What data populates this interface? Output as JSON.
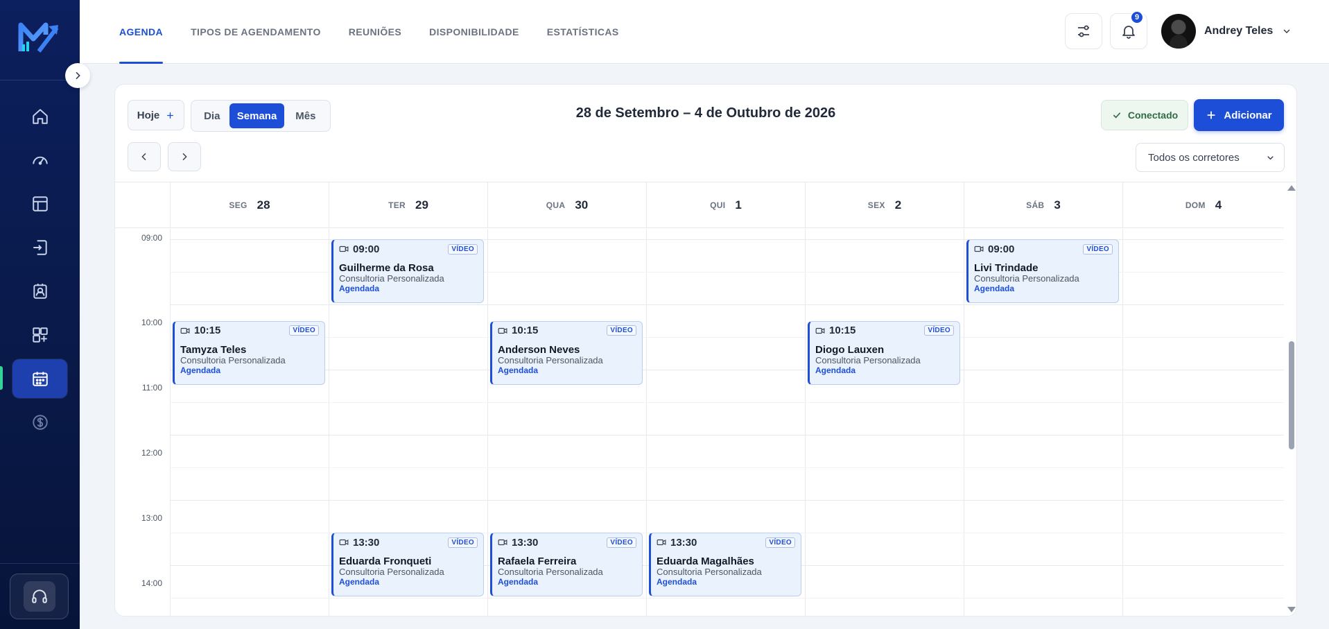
{
  "app": {
    "title": "Agenda"
  },
  "colors": {
    "accent": "#1d4ed8",
    "sidebar": "#0c1f5e",
    "active_indicator": "#34d399",
    "event_bg": "#eaf2fd"
  },
  "sidebar": {
    "items": [
      {
        "icon": "home-icon"
      },
      {
        "icon": "gauge-icon"
      },
      {
        "icon": "layout-icon"
      },
      {
        "icon": "file-import-icon"
      },
      {
        "icon": "contact-icon"
      },
      {
        "icon": "widgets-add-icon"
      },
      {
        "icon": "calendar-icon",
        "active": true
      },
      {
        "icon": "dollar-icon"
      }
    ],
    "support_icon": "headset-icon"
  },
  "header": {
    "tabs": [
      {
        "label": "AGENDA",
        "active": true
      },
      {
        "label": "TIPOS DE AGENDAMENTO"
      },
      {
        "label": "REUNIÕES"
      },
      {
        "label": "DISPONIBILIDADE"
      },
      {
        "label": "ESTATÍSTICAS"
      }
    ],
    "notifications_count": "9",
    "user_name": "Andrey Teles"
  },
  "toolbar": {
    "today_label": "Hoje",
    "views": [
      {
        "label": "Dia"
      },
      {
        "label": "Semana",
        "active": true
      },
      {
        "label": "Mês"
      }
    ],
    "range_title": "28 de Setembro – 4 de Outubro de 2026",
    "connected_label": "Conectado",
    "add_label": "Adicionar",
    "broker_filter": "Todos os corretores"
  },
  "calendar": {
    "days": [
      {
        "name": "SEG",
        "date": "28"
      },
      {
        "name": "TER",
        "date": "29"
      },
      {
        "name": "QUA",
        "date": "30"
      },
      {
        "name": "QUI",
        "date": "1"
      },
      {
        "name": "SEX",
        "date": "2"
      },
      {
        "name": "SÁB",
        "date": "3"
      },
      {
        "name": "DOM",
        "date": "4"
      }
    ],
    "hours": [
      "09:00",
      "10:00",
      "11:00",
      "12:00",
      "13:00",
      "14:00"
    ],
    "events": [
      {
        "day": 1,
        "start": "09:00",
        "tag": "VÍDEO",
        "name": "Guilherme da Rosa",
        "type": "Consultoria Personalizada",
        "status": "Agendada"
      },
      {
        "day": 5,
        "start": "09:00",
        "tag": "VÍDEO",
        "name": "Livi Trindade",
        "type": "Consultoria Personalizada",
        "status": "Agendada"
      },
      {
        "day": 0,
        "start": "10:15",
        "tag": "VÍDEO",
        "name": "Tamyza Teles",
        "type": "Consultoria Personalizada",
        "status": "Agendada"
      },
      {
        "day": 2,
        "start": "10:15",
        "tag": "VÍDEO",
        "name": "Anderson Neves",
        "type": "Consultoria Personalizada",
        "status": "Agendada"
      },
      {
        "day": 4,
        "start": "10:15",
        "tag": "VÍDEO",
        "name": "Diogo Lauxen",
        "type": "Consultoria Personalizada",
        "status": "Agendada"
      },
      {
        "day": 1,
        "start": "13:30",
        "tag": "VÍDEO",
        "name": "Eduarda Fronqueti",
        "type": "Consultoria Personalizada",
        "status": "Agendada"
      },
      {
        "day": 2,
        "start": "13:30",
        "tag": "VÍDEO",
        "name": "Rafaela Ferreira",
        "type": "Consultoria Personalizada",
        "status": "Agendada"
      },
      {
        "day": 3,
        "start": "13:30",
        "tag": "VÍDEO",
        "name": "Eduarda Magalhães",
        "type": "Consultoria Personalizada",
        "status": "Agendada"
      }
    ]
  }
}
